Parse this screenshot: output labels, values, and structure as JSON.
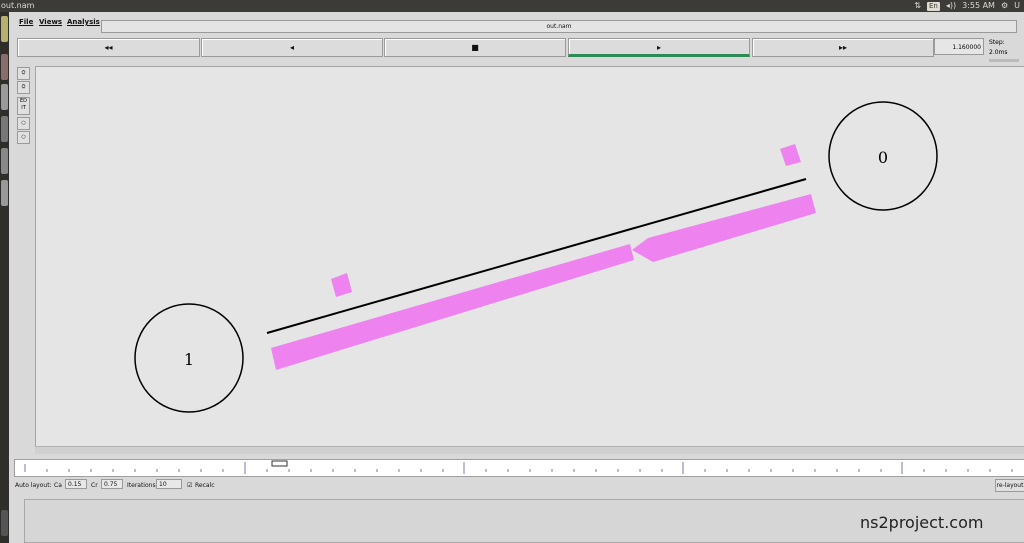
{
  "window": {
    "title": "out.nam",
    "file_field": "out.nam"
  },
  "tray": {
    "lang": "En",
    "time": "3:55 AM",
    "user": "U"
  },
  "menus": [
    "File",
    "Views",
    "Analysis"
  ],
  "controls": [
    "◂◂",
    "◂",
    "■",
    "▸",
    "▸▸"
  ],
  "time_value": "1.160000",
  "step_label": "Step: 2.0ms",
  "tools": [
    "ED\nIT"
  ],
  "nodes": [
    {
      "label": "0"
    },
    {
      "label": "1"
    }
  ],
  "autolayout": {
    "label": "Auto layout:",
    "ca_label": "Ca",
    "ca_value": "0.15",
    "cr_label": "Cr",
    "cr_value": "0.75",
    "iter_label": "Iterations",
    "iter_value": "10",
    "recalc_label": "Recalc",
    "relayout_label": "re-layout"
  },
  "watermark": "ns2project.com",
  "colors": {
    "packet": "#ee82ee",
    "active_underline": "#2e8b57"
  }
}
